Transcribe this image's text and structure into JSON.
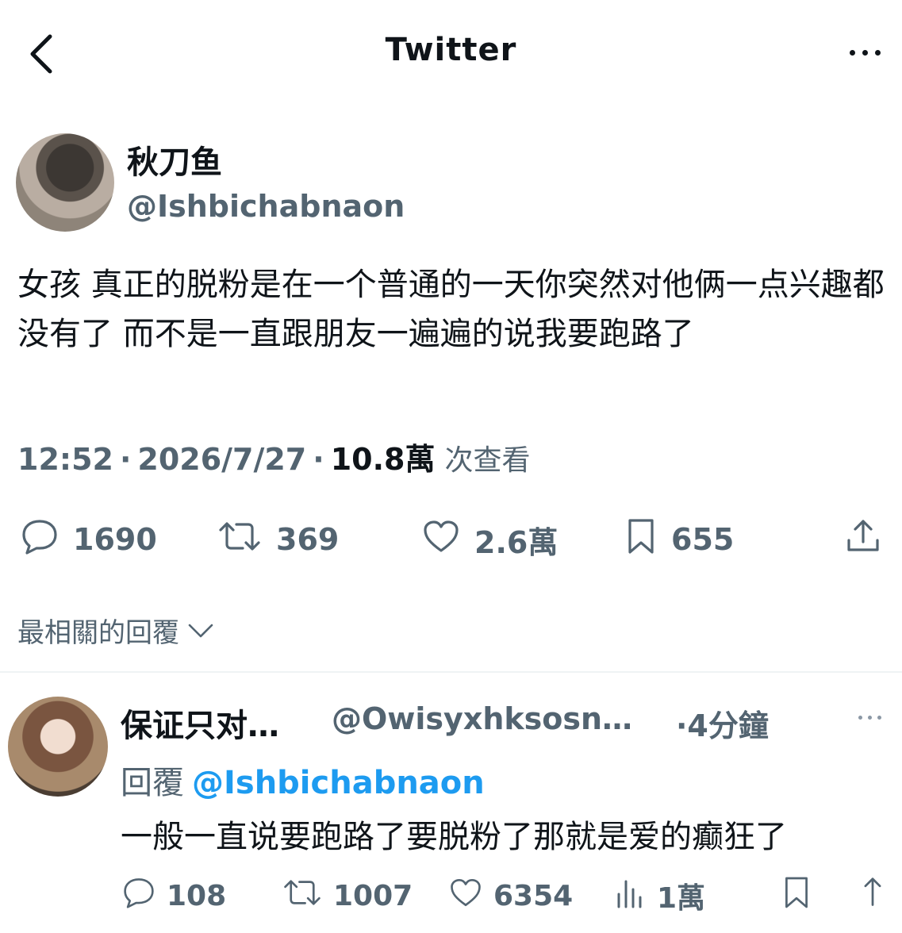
{
  "header": {
    "title": "Twitter",
    "back_icon": "chevron-left-icon",
    "more_icon": "more-horizontal-icon"
  },
  "tweet": {
    "display_name": "秋刀鱼",
    "handle": "@Ishbichabnaon",
    "text": "女孩 真正的脱粉是在一个普通的一天你突然对他俩一点兴趣都没有了 而不是一直跟朋友一遍遍的说我要跑路了",
    "time": "12:52",
    "date": "2026/7/27",
    "views": "10.8萬",
    "views_label": "次查看",
    "stats": {
      "replies": "1690",
      "retweets": "369",
      "likes": "2.6萬",
      "bookmarks": "655"
    }
  },
  "sort_label": "最相關的回覆",
  "reply": {
    "display_name": "保证只对…",
    "handle": "@Owisyxhksosn…",
    "time": "·4分鐘",
    "replying_to_label": "回覆",
    "replying_to_handle": "@Ishbichabnaon",
    "text": "一般一直说要跑路了要脱粉了那就是爱的癫狂了",
    "stats": {
      "replies": "108",
      "retweets": "1007",
      "likes": "6354",
      "views": "1萬"
    }
  },
  "colors": {
    "accent": "#1d9bf0",
    "text": "#0f1419",
    "muted": "#536471"
  }
}
